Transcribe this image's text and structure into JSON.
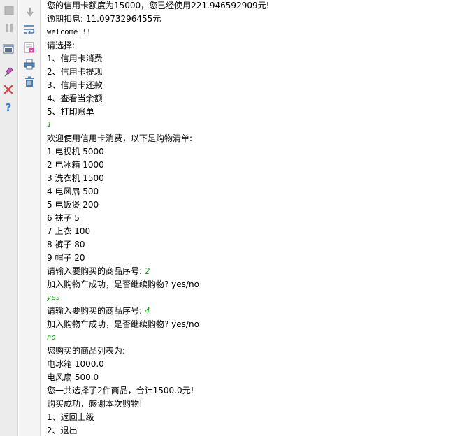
{
  "toolbar": {
    "left": [
      {
        "name": "stop-icon"
      },
      {
        "name": "pause-icon"
      },
      {
        "name": "restore-layout-icon"
      },
      {
        "name": "pin-tab-icon"
      },
      {
        "name": "close-icon"
      },
      {
        "name": "help-icon"
      }
    ],
    "right": [
      {
        "name": "scroll-to-end-icon"
      },
      {
        "name": "soft-wrap-icon"
      },
      {
        "name": "scroll-lock-icon"
      },
      {
        "name": "print-icon"
      },
      {
        "name": "clear-all-icon"
      }
    ]
  },
  "console": {
    "lines": [
      {
        "text": "您的信用卡额度为15000，您已经使用221.946592909元!"
      },
      {
        "text": "逾期扣息: 11.0973296455元"
      },
      {
        "text": "welcome!!!"
      },
      {
        "text": "请选择:"
      },
      {
        "text": "1、信用卡消费"
      },
      {
        "text": "2、信用卡提现"
      },
      {
        "text": "3、信用卡还款"
      },
      {
        "text": "4、查看当余额"
      },
      {
        "text": "5、打印账单"
      },
      {
        "text": "1"
      },
      {
        "text": "欢迎使用信用卡消费，以下是购物清单:"
      },
      {
        "text": "1 电视机 5000"
      },
      {
        "text": "2 电冰箱 1000"
      },
      {
        "text": "3 洗衣机 1500"
      },
      {
        "text": "4 电风扇 500"
      },
      {
        "text": "5 电饭煲 200"
      },
      {
        "text": "6 袜子 5"
      },
      {
        "text": "7 上衣 100"
      },
      {
        "text": "8 裤子 80"
      },
      {
        "text": "9 帽子 20"
      },
      {
        "prompt": "请输入要购买的商品序号: ",
        "input": "2"
      },
      {
        "text": "加入购物车成功，是否继续购物? yes/no"
      },
      {
        "text": "yes"
      },
      {
        "prompt": "请输入要购买的商品序号: ",
        "input": "4"
      },
      {
        "text": "加入购物车成功，是否继续购物? yes/no"
      },
      {
        "text": "no"
      },
      {
        "text": "您购买的商品列表为:"
      },
      {
        "text": "电冰箱 1000.0"
      },
      {
        "text": "电风扇 500.0"
      },
      {
        "text": "您一共选择了2件商品，合计1500.0元!"
      },
      {
        "text": "购买成功，感谢本次购物!"
      },
      {
        "text": "1、返回上级"
      },
      {
        "text": "2、退出"
      }
    ]
  },
  "colors": {
    "user_input": "#20a020",
    "toolbar_bg": "#ececec",
    "close_red": "#e04040",
    "help_blue": "#3a7fd0"
  }
}
